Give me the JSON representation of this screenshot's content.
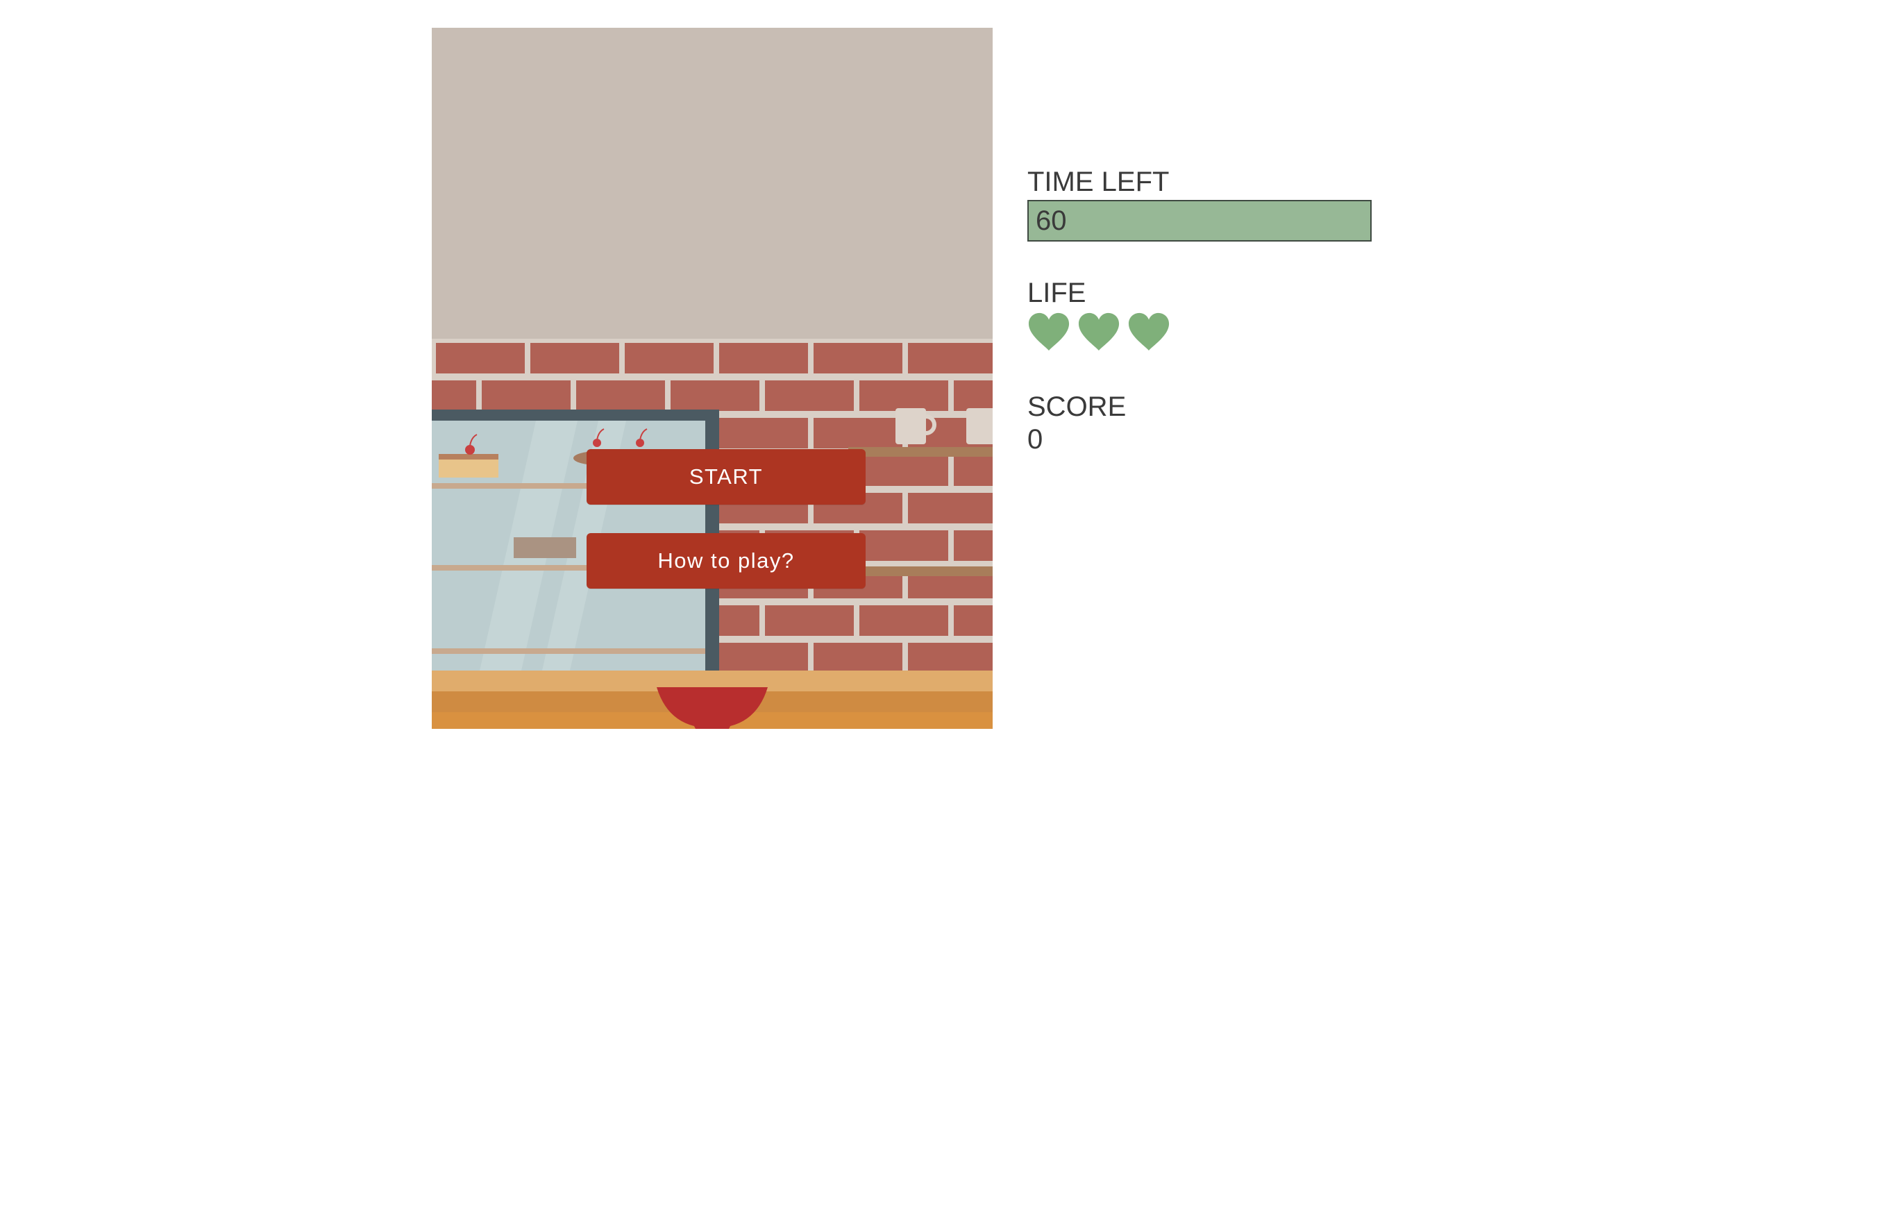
{
  "game": {
    "start_label": "START",
    "howto_label": "How to play?"
  },
  "hud": {
    "time_label": "TIME LEFT",
    "time_value": "60",
    "time_progress": 1.0,
    "life_label": "LIFE",
    "lives": 3,
    "score_label": "SCORE",
    "score_value": "0"
  },
  "colors": {
    "button": "#ad3522",
    "time_bar": "#97b896",
    "heart": "#7fb07a",
    "wall": "#c8bdb4",
    "brick": "#b06155",
    "counter": "#dda764"
  },
  "icons": [
    "heart-icon",
    "heart-icon",
    "heart-icon"
  ]
}
